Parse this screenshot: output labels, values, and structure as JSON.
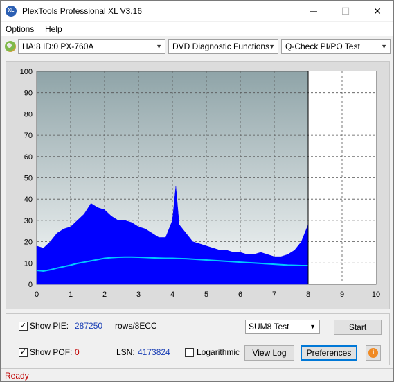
{
  "window": {
    "title": "PlexTools Professional XL V3.16",
    "icon": "XL",
    "minimize": "─",
    "maximize": "☐",
    "close": "✕"
  },
  "menu": [
    {
      "label": "Options",
      "key": "O"
    },
    {
      "label": "Help",
      "key": "H"
    }
  ],
  "toolbar": {
    "drive": "HA:8 ID:0  PX-760A",
    "function": "DVD Diagnostic Functions",
    "test": "Q-Check PI/PO Test"
  },
  "chart_data": {
    "type": "area",
    "title": "",
    "xlabel": "",
    "ylabel": "",
    "xlim": [
      0,
      10
    ],
    "ylim": [
      0,
      100
    ],
    "x_ticks": [
      "0",
      "1",
      "2",
      "3",
      "4",
      "5",
      "6",
      "7",
      "8",
      "9",
      "10"
    ],
    "y_ticks": [
      "0",
      "10",
      "20",
      "30",
      "40",
      "50",
      "60",
      "70",
      "80",
      "90",
      "100"
    ],
    "grid": true,
    "data_end_x": 8,
    "series": [
      {
        "color": "#0000ff",
        "x": [
          0,
          0.2,
          0.4,
          0.6,
          0.8,
          1.0,
          1.2,
          1.4,
          1.6,
          1.8,
          2.0,
          2.2,
          2.4,
          2.6,
          2.8,
          3.0,
          3.2,
          3.4,
          3.6,
          3.8,
          4.0,
          4.1,
          4.2,
          4.4,
          4.6,
          4.8,
          5.0,
          5.2,
          5.4,
          5.6,
          5.8,
          6.0,
          6.2,
          6.4,
          6.6,
          6.8,
          7.0,
          7.2,
          7.4,
          7.6,
          7.8,
          8.0
        ],
        "values": [
          18,
          17,
          20,
          24,
          26,
          27,
          30,
          33,
          38,
          36,
          35,
          32,
          30,
          30,
          29,
          27,
          26,
          24,
          22,
          22,
          30,
          46,
          28,
          24,
          20,
          19,
          18,
          17,
          16,
          16,
          15,
          15,
          14,
          14,
          15,
          14,
          13,
          13,
          14,
          16,
          20,
          28
        ]
      },
      {
        "color": "#00c8ff",
        "x": [
          0,
          0.2,
          0.4,
          0.6,
          0.8,
          1.0,
          1.2,
          1.4,
          1.6,
          1.8,
          2.0,
          2.2,
          2.4,
          2.6,
          2.8,
          3.0,
          3.2,
          3.4,
          3.6,
          3.8,
          4.0,
          4.2,
          4.4,
          4.6,
          4.8,
          5.0,
          5.2,
          5.4,
          5.6,
          5.8,
          6.0,
          6.2,
          6.4,
          6.6,
          6.8,
          7.0,
          7.2,
          7.4,
          7.6,
          7.8,
          8.0
        ],
        "values": [
          6.5,
          6.2,
          6.8,
          7.6,
          8.3,
          9.0,
          9.8,
          10.4,
          11.0,
          11.6,
          12.2,
          12.5,
          12.7,
          12.8,
          12.8,
          12.7,
          12.6,
          12.4,
          12.3,
          12.2,
          12.2,
          12.1,
          12.0,
          11.8,
          11.6,
          11.4,
          11.2,
          11.0,
          10.8,
          10.6,
          10.4,
          10.2,
          10.0,
          9.8,
          9.6,
          9.4,
          9.2,
          9.0,
          8.9,
          8.8,
          8.8
        ]
      }
    ]
  },
  "panel": {
    "show_pie_label": "Show PIE:",
    "pie_value": "287250",
    "pie_unit": "rows/8ECC",
    "show_pof_label": "Show POF:",
    "pof_value": "0",
    "lsn_label": "LSN:",
    "lsn_value": "4173824",
    "logarithmic_label": "Logarithmic",
    "test_mode": "SUM8 Test",
    "start_button": "Start",
    "view_log_button": "View Log",
    "preferences_button": "Preferences",
    "show_pie_checked": "✓",
    "show_pof_checked": "✓"
  },
  "status": "Ready"
}
